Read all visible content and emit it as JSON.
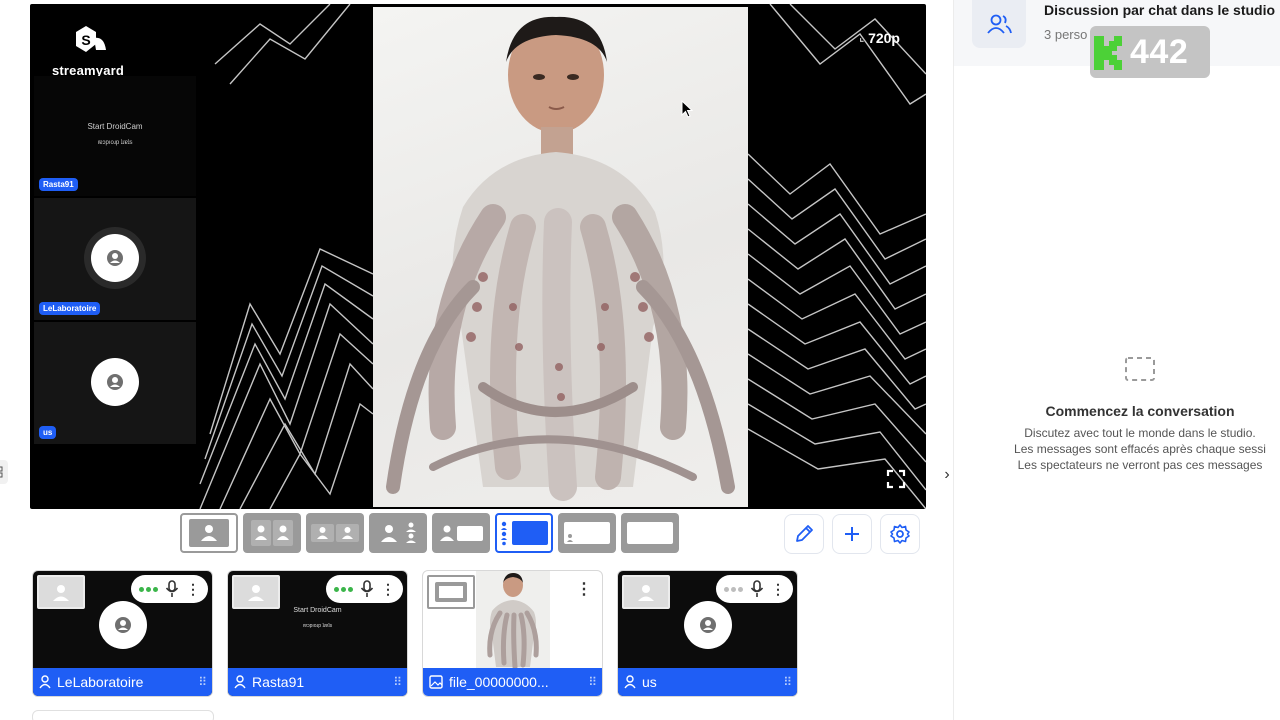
{
  "stage": {
    "brand_name": "streamyard",
    "quality": "720p",
    "side_tiles": [
      {
        "name": "Rasta91",
        "screen_line1": "Start DroidCam",
        "screen_line2": "ıɐɔpıoɹp ʇɹɐʇs"
      },
      {
        "name": "LeLaboratoire"
      },
      {
        "name": "us"
      }
    ]
  },
  "layouts": {
    "count": 8,
    "selected_index": 5
  },
  "participants": [
    {
      "name": "LeLaboratoire",
      "type": "camera",
      "mic_active": true
    },
    {
      "name": "Rasta91",
      "type": "screen",
      "mic_active": true,
      "screen_line1": "Start DroidCam",
      "screen_line2": "ıɐɔpıoɹp ʇɹɐʇs"
    },
    {
      "name": "file_00000000...",
      "type": "file"
    },
    {
      "name": "us",
      "type": "camera",
      "mic_active": false
    }
  ],
  "chat": {
    "title": "Discussion par chat dans le studio",
    "subtitle": "3 perso",
    "viewer_count": "442",
    "empty_title": "Commencez la conversation",
    "empty_lines": [
      "Discutez avec tout le monde dans le studio.",
      "Les messages sont effacés après chaque sessi",
      "Les spectateurs ne verront pas ces messages"
    ]
  },
  "colors": {
    "accent": "#1f5ef5",
    "mic_active": "#3bb54a",
    "viewer_badge_green": "#4cd137"
  }
}
